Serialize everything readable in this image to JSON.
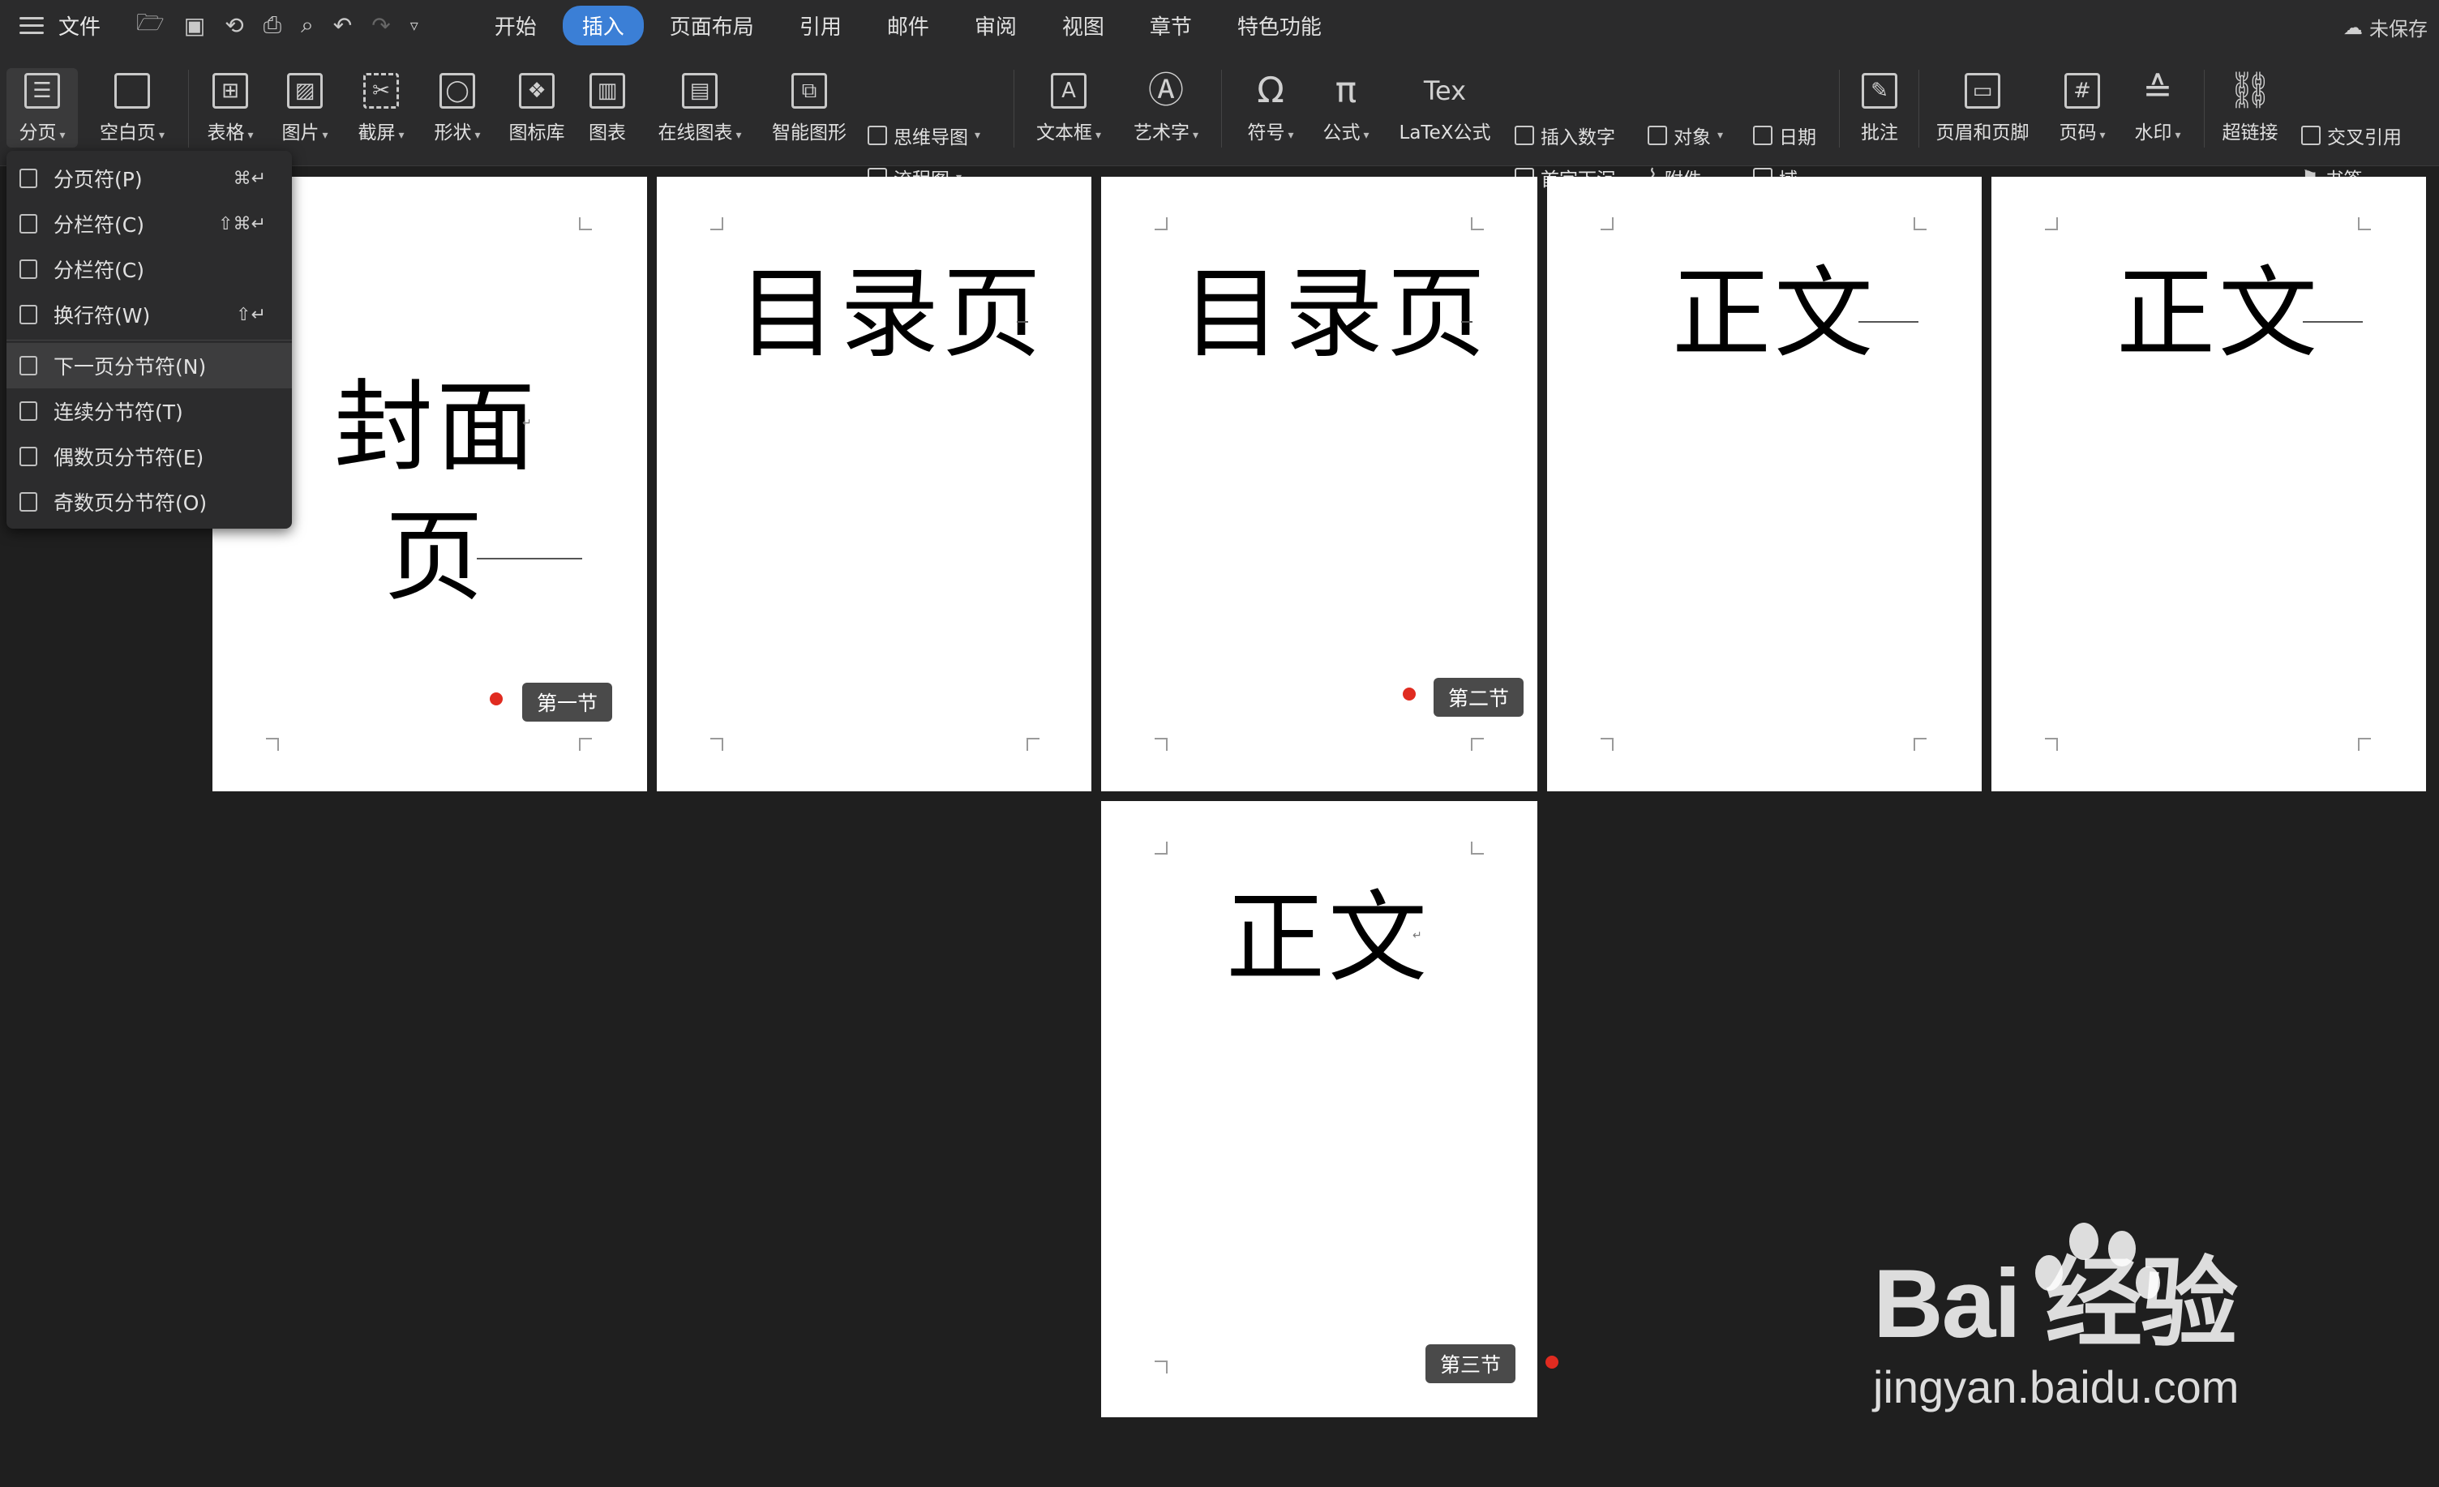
{
  "menubar": {
    "file_label": "文件",
    "tabs": [
      {
        "label": "开始",
        "active": false
      },
      {
        "label": "插入",
        "active": true
      },
      {
        "label": "页面布局",
        "active": false
      },
      {
        "label": "引用",
        "active": false
      },
      {
        "label": "邮件",
        "active": false
      },
      {
        "label": "审阅",
        "active": false
      },
      {
        "label": "视图",
        "active": false
      },
      {
        "label": "章节",
        "active": false
      },
      {
        "label": "特色功能",
        "active": false
      }
    ],
    "unsaved_label": "未保存",
    "accent_color": "#3b7fd6"
  },
  "ribbon": {
    "page_break": "分页",
    "blank_page": "空白页",
    "table": "表格",
    "picture": "图片",
    "screenshot": "截屏",
    "shape": "形状",
    "icon_library": "图标库",
    "chart": "图表",
    "online_chart": "在线图表",
    "smart_art": "智能图形",
    "mind_map": "思维导图",
    "flowchart": "流程图",
    "text_box": "文本框",
    "word_art": "艺术字",
    "symbol": "符号",
    "formula": "公式",
    "latex": "LaTeX公式",
    "insert_number": "插入数字",
    "drop_cap": "首字下沉",
    "object": "对象",
    "attachment": "附件",
    "date": "日期",
    "field": "域",
    "comment": "批注",
    "header_footer": "页眉和页脚",
    "page_number": "页码",
    "watermark": "水印",
    "hyperlink": "超链接",
    "cross_ref": "交叉引用",
    "bookmark": "书签"
  },
  "dropdown": {
    "items": [
      {
        "label": "分页符(P)",
        "shortcut": "⌘↵"
      },
      {
        "label": "分栏符(C)",
        "shortcut": "⇧⌘↵"
      },
      {
        "label": "分栏符(C)",
        "shortcut": ""
      },
      {
        "label": "换行符(W)",
        "shortcut": "⇧↵"
      },
      {
        "label": "下一页分节符(N)",
        "shortcut": ""
      },
      {
        "label": "连续分节符(T)",
        "shortcut": ""
      },
      {
        "label": "偶数页分节符(E)",
        "shortcut": ""
      },
      {
        "label": "奇数页分节符(O)",
        "shortcut": ""
      }
    ]
  },
  "pages": {
    "cover_line1": "封面",
    "cover_line2": "页",
    "toc1": "目录页",
    "toc2": "目录页",
    "body1": "正文",
    "body2": "正文",
    "body3": "正文"
  },
  "sections": {
    "first": "第一节",
    "second": "第二节",
    "third": "第三节"
  },
  "watermark": {
    "brand": "Bai  经验",
    "url": "jingyan.baidu.com"
  }
}
